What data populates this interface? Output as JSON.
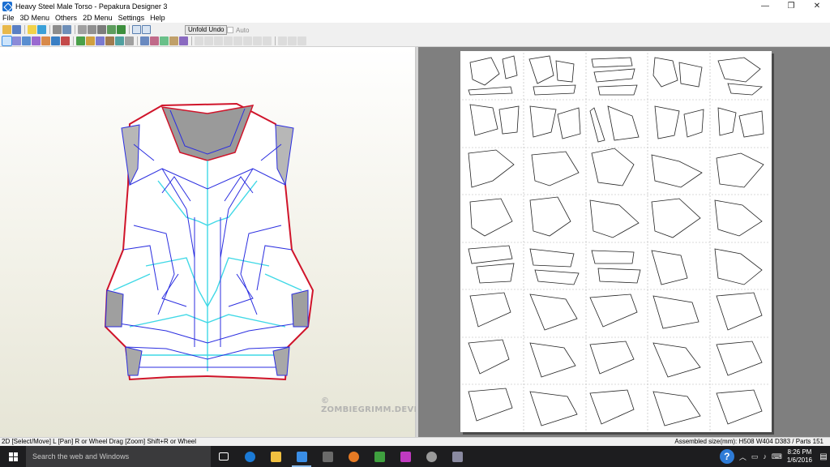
{
  "window": {
    "title": "Heavy Steel Male Torso - Pepakura Designer 3",
    "controls": {
      "minimize": "—",
      "maximize": "❐",
      "close": "✕"
    }
  },
  "menu": {
    "items": [
      "File",
      "3D Menu",
      "Others",
      "2D Menu",
      "Settings",
      "Help"
    ]
  },
  "toolbar": {
    "unfold_undo": "Unfold Undo",
    "auto_label": "Auto"
  },
  "status": {
    "left": "2D [Select/Move] L [Pan] R or Wheel Drag [Zoom] Shift+R or Wheel",
    "right": "Assembled size(mm): H508 W404 D383 / Parts 151"
  },
  "watermark": "© ZOMBIEGRIMM.DEVIANTART.COM",
  "taskbar": {
    "search_placeholder": "Search the web and Windows",
    "apps": [
      "task-view-icon",
      "edge-icon",
      "file-explorer-icon",
      "pepakura-icon",
      "store-icon",
      "firefox-icon",
      "paint-icon",
      "design-icon",
      "fan-icon",
      "pepakura-2-icon"
    ],
    "time": "8:26 PM",
    "date": "1/6/2016",
    "help": "?"
  },
  "colors": {
    "model_edge": "#2b2ee0",
    "fold_line": "#3fd8e6",
    "cut_edge": "#d0142a",
    "paper_bg": "#ffffff",
    "view2d_bg": "#7f7f7f"
  }
}
